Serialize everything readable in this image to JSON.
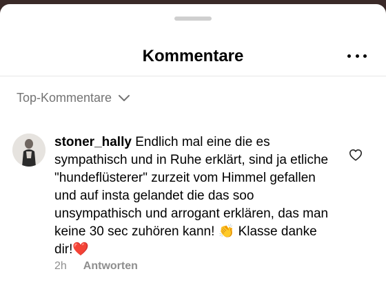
{
  "header": {
    "title": "Kommentare",
    "more_icon": "more-horizontal-icon"
  },
  "sort": {
    "label": "Top-Kommentare",
    "icon": "chevron-down-icon"
  },
  "comment": {
    "username": "stoner_hally",
    "text": "Endlich mal eine die es sympathisch und in Ruhe erklärt, sind ja etliche \"hundeflüsterer\" zurzeit vom Himmel gefallen und auf insta gelandet die das soo unsympathisch und arrogant erklären, das man keine 30 sec zuhören kann! 👏 Klasse danke dir!❤️",
    "time": "2h",
    "reply_label": "Antworten",
    "like_icon": "heart-outline-icon"
  },
  "colors": {
    "muted": "#737373",
    "meta": "#8e8e8e",
    "grabber": "#cfcfcf"
  }
}
